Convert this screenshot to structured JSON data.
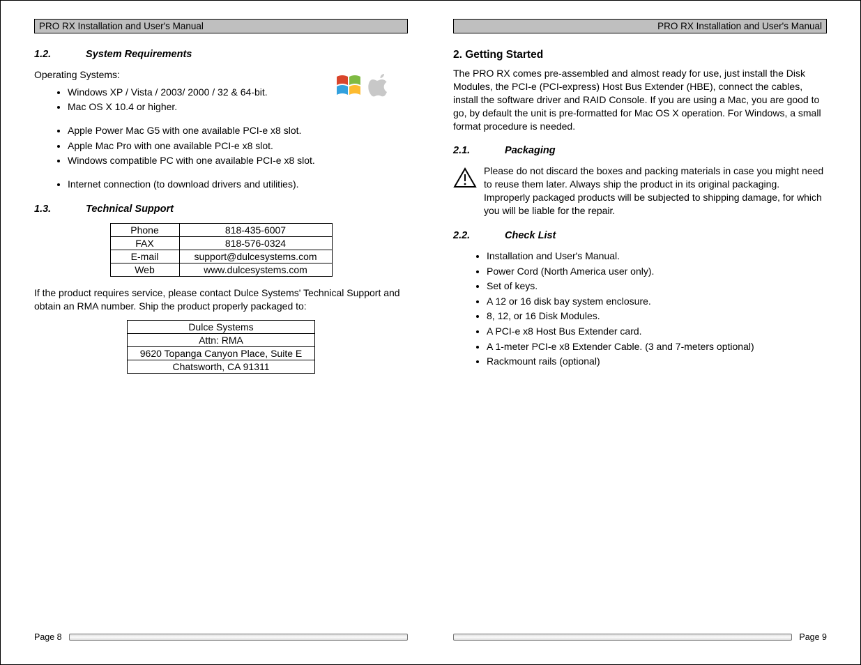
{
  "header_title": "PRO RX Installation and User's Manual",
  "left": {
    "sections": {
      "sysreq": {
        "num": "1.2.",
        "title": "System Requirements"
      },
      "techsup": {
        "num": "1.3.",
        "title": "Technical Support"
      }
    },
    "os_label": "Operating Systems:",
    "os_list_a": [
      "Windows XP / Vista / 2003/ 2000 /  32 & 64-bit.",
      "Mac OS X 10.4 or higher."
    ],
    "hw_list": [
      "Apple Power Mac G5 with one available PCI-e x8 slot.",
      "Apple Mac Pro with one available PCI-e x8 slot.",
      "Windows compatible PC with one available PCI-e x8 slot."
    ],
    "net_list": [
      "Internet connection (to download drivers and utilities)."
    ],
    "contact": [
      {
        "label": "Phone",
        "value": "818-435-6007"
      },
      {
        "label": "FAX",
        "value": "818-576-0324"
      },
      {
        "label": "E-mail",
        "value": "support@dulcesystems.com"
      },
      {
        "label": "Web",
        "value": "www.dulcesystems.com"
      }
    ],
    "rma_text": "If the product requires service, please contact Dulce Systems' Technical Support and obtain an RMA number.  Ship the product properly packaged to:",
    "address": [
      "Dulce Systems",
      "Attn: RMA",
      "9620 Topanga Canyon Place, Suite E",
      "Chatsworth, CA  91311"
    ],
    "page_num": "Page 8"
  },
  "right": {
    "h2": "2. Getting Started",
    "intro": "The PRO RX comes pre-assembled and almost ready for use, just install the Disk Modules, the PCI-e (PCI-express) Host Bus Extender (HBE), connect the cables, install the software driver and RAID Console.   If you are using a Mac, you are good to go, by default the unit is pre-formatted for Mac OS X operation.  For Windows, a small format procedure is needed.",
    "sections": {
      "packaging": {
        "num": "2.1.",
        "title": "Packaging"
      },
      "checklist": {
        "num": "2.2.",
        "title": "Check List"
      }
    },
    "packaging_text": "Please do not discard the boxes and packing materials in case you might need to reuse them later.  Always ship the product in its original packaging.  Improperly packaged products will be subjected to shipping damage, for which you will be liable for the repair.",
    "checklist": [
      "Installation and User's Manual.",
      "Power Cord (North America user only).",
      "Set of keys.",
      "A 12 or 16 disk bay system enclosure.",
      "8, 12, or 16 Disk Modules.",
      "A PCI-e x8 Host Bus Extender card.",
      "A 1-meter PCI-e x8 Extender Cable.  (3 and 7-meters optional)",
      "Rackmount rails (optional)"
    ],
    "page_num": "Page 9"
  }
}
